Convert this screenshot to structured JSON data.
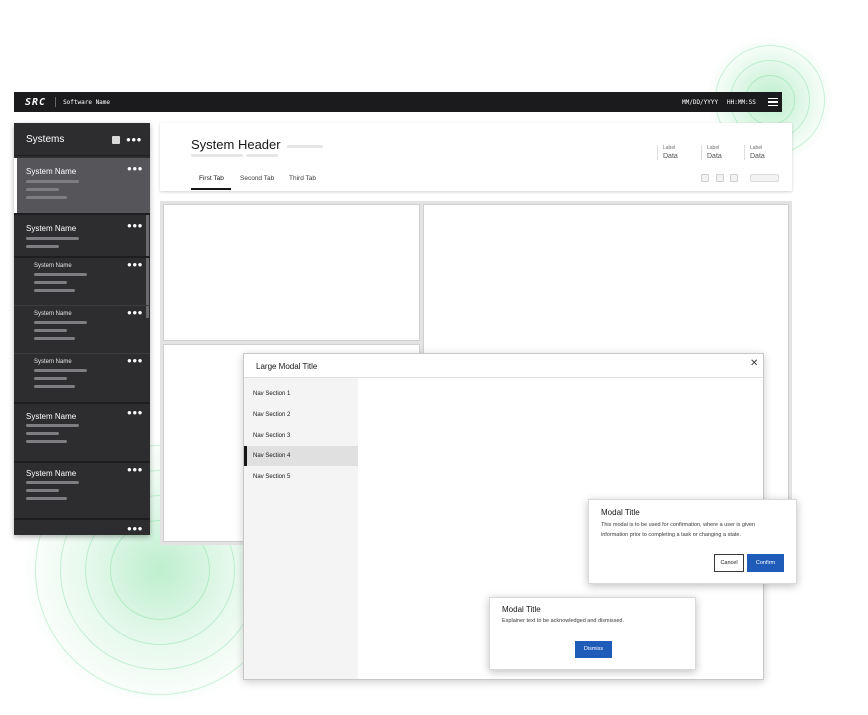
{
  "topbar": {
    "logo": "SRC",
    "app_name": "Software Name",
    "date": "MM/DD/YYYY",
    "time": "HH:MM:SS",
    "menu_icon": "hamburger-menu-icon"
  },
  "sidebar": {
    "title": "Systems",
    "items": [
      {
        "label": "System Name",
        "level": "top",
        "selected": true
      },
      {
        "label": "System Name",
        "level": "top",
        "selected": false
      },
      {
        "label": "System Name",
        "level": "sub",
        "selected": false
      },
      {
        "label": "System Name",
        "level": "sub",
        "selected": false
      },
      {
        "label": "System Name",
        "level": "sub",
        "selected": false
      },
      {
        "label": "System Name",
        "level": "top",
        "selected": false
      },
      {
        "label": "System Name",
        "level": "top",
        "selected": false
      }
    ]
  },
  "header": {
    "title": "System Header",
    "fields": [
      {
        "label": "Label",
        "value": "Data"
      },
      {
        "label": "Label",
        "value": "Data"
      },
      {
        "label": "Label",
        "value": "Data"
      }
    ],
    "tabs": [
      {
        "label": "First Tab",
        "active": true
      },
      {
        "label": "Second Tab",
        "active": false
      },
      {
        "label": "Third Tab",
        "active": false
      }
    ]
  },
  "large_modal": {
    "title": "Large Modal Title",
    "close_icon": "close-icon",
    "nav": [
      {
        "label": "Nav Section 1",
        "active": false
      },
      {
        "label": "Nav Section 2",
        "active": false
      },
      {
        "label": "Nav Section 3",
        "active": false
      },
      {
        "label": "Nav Section 4",
        "active": true
      },
      {
        "label": "Nav Section 5",
        "active": false
      }
    ]
  },
  "confirm_modal": {
    "title": "Modal Title",
    "text": "This modal is to be used for confirmation, where a user is given information prior to completing a task or changing a state.",
    "cancel_label": "Cancel",
    "confirm_label": "Confirm"
  },
  "ack_modal": {
    "title": "Modal Title",
    "text": "Explainer text to be acknowledged and dismissed.",
    "dismiss_label": "Dismiss"
  },
  "colors": {
    "primary": "#1f5bb8",
    "topbar": "#1b1b1d",
    "sidebar": "#2d2d2f",
    "glow": "#24c85a"
  }
}
